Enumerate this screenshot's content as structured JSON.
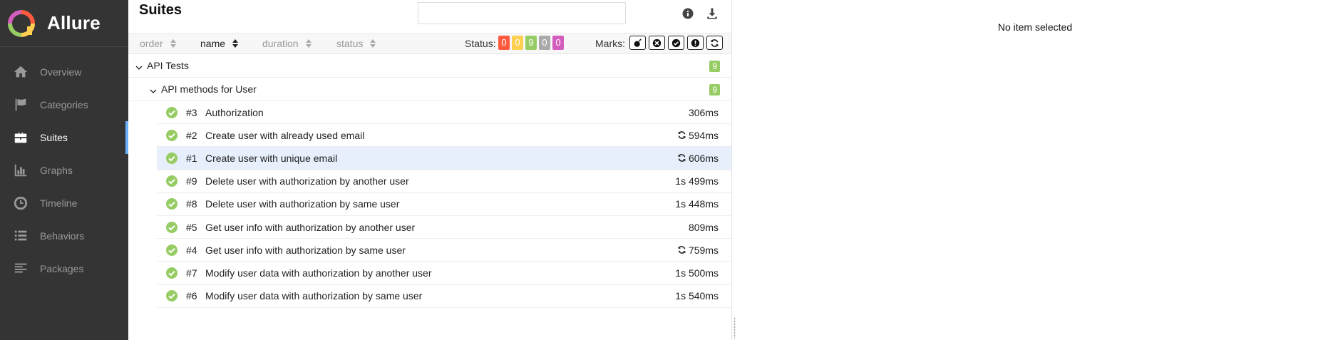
{
  "app": {
    "name": "Allure"
  },
  "sidebar": {
    "items": [
      {
        "label": "Overview",
        "icon": "home-icon",
        "active": false
      },
      {
        "label": "Categories",
        "icon": "flag-icon",
        "active": false
      },
      {
        "label": "Suites",
        "icon": "briefcase-icon",
        "active": true
      },
      {
        "label": "Graphs",
        "icon": "bar-chart-icon",
        "active": false
      },
      {
        "label": "Timeline",
        "icon": "clock-icon",
        "active": false
      },
      {
        "label": "Behaviors",
        "icon": "list-icon",
        "active": false
      },
      {
        "label": "Packages",
        "icon": "align-left-icon",
        "active": false
      }
    ]
  },
  "suites": {
    "title": "Suites",
    "search": {
      "value": "",
      "placeholder": ""
    },
    "sorters": [
      {
        "label": "order",
        "active": false
      },
      {
        "label": "name",
        "active": true
      },
      {
        "label": "duration",
        "active": false
      },
      {
        "label": "status",
        "active": false
      }
    ],
    "status_label": "Status:",
    "status_badges": [
      {
        "label": "0",
        "color": "#fd5a3e",
        "name": "failed"
      },
      {
        "label": "0",
        "color": "#ffd050",
        "name": "broken"
      },
      {
        "label": "9",
        "color": "#97cc64",
        "name": "passed"
      },
      {
        "label": "0",
        "color": "#aaaaaa",
        "name": "skipped"
      },
      {
        "label": "0",
        "color": "#d35ebe",
        "name": "unknown"
      }
    ],
    "marks_label": "Marks:",
    "marks": [
      "bomb-icon",
      "cross-circle-icon",
      "check-circle-icon",
      "exclamation-icon",
      "refresh-icon"
    ],
    "tree": {
      "root": {
        "name": "API Tests",
        "count": "9"
      },
      "child": {
        "name": "API methods for User",
        "count": "9"
      },
      "tests": [
        {
          "num": "#3",
          "name": "Authorization",
          "duration": "306ms",
          "retry": false,
          "selected": false
        },
        {
          "num": "#2",
          "name": "Create user with already used email",
          "duration": "594ms",
          "retry": true,
          "selected": false
        },
        {
          "num": "#1",
          "name": "Create user with unique email",
          "duration": "606ms",
          "retry": true,
          "selected": true
        },
        {
          "num": "#9",
          "name": "Delete user with authorization by another user",
          "duration": "1s 499ms",
          "retry": false,
          "selected": false
        },
        {
          "num": "#8",
          "name": "Delete user with authorization by same user",
          "duration": "1s 448ms",
          "retry": false,
          "selected": false
        },
        {
          "num": "#5",
          "name": "Get user info with authorization by another user",
          "duration": "809ms",
          "retry": false,
          "selected": false
        },
        {
          "num": "#4",
          "name": "Get user info with authorization by same user",
          "duration": "759ms",
          "retry": true,
          "selected": false
        },
        {
          "num": "#7",
          "name": "Modify user data with authorization by another user",
          "duration": "1s 500ms",
          "retry": false,
          "selected": false
        },
        {
          "num": "#6",
          "name": "Modify user data with authorization by same user",
          "duration": "1s 540ms",
          "retry": false,
          "selected": false
        }
      ]
    }
  },
  "detail": {
    "empty_message": "No item selected"
  },
  "colors": {
    "sidebar_bg": "#343434",
    "active_accent": "#6bb0ff",
    "passed": "#97cc64",
    "selected_row": "#e6effb"
  }
}
